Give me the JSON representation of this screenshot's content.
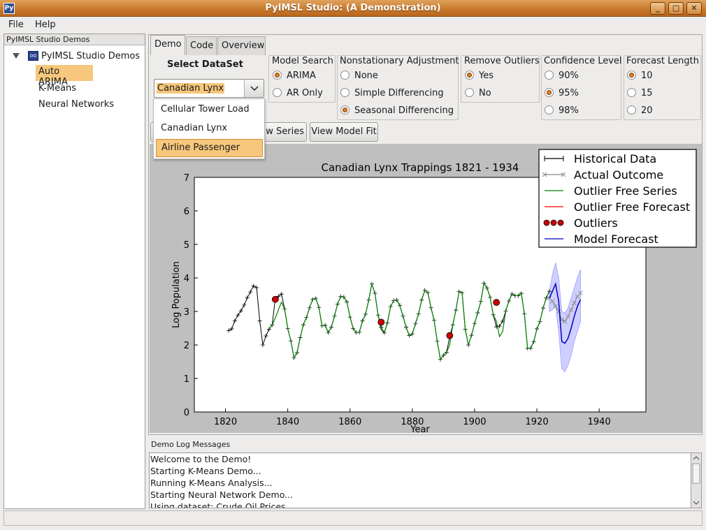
{
  "window": {
    "title": "PyIMSL Studio: (A Demonstration)",
    "app_icon": "Py",
    "min": "_",
    "max": "□",
    "close": "✕"
  },
  "menubar": {
    "file": "File",
    "help": "Help"
  },
  "sidebar": {
    "header": "PyIMSL Studio Demos",
    "root": "PyIMSL Studio Demos",
    "items": [
      {
        "label": "Auto ARIMA",
        "selected": true
      },
      {
        "label": "K-Means",
        "selected": false
      },
      {
        "label": "Neural Networks",
        "selected": false
      }
    ]
  },
  "tabs": [
    {
      "label": "Demo",
      "active": true
    },
    {
      "label": "Code",
      "active": false
    },
    {
      "label": "Overview",
      "active": false
    }
  ],
  "dataset": {
    "title": "Select DataSet",
    "selected": "Canadian Lynx",
    "options": [
      "Cellular Tower Load",
      "Canadian Lynx",
      "Airline Passenger"
    ],
    "highlighted": "Airline Passenger"
  },
  "groups": {
    "model_search": {
      "title": "Model Search",
      "options": [
        "ARIMA",
        "AR Only"
      ],
      "selected": "ARIMA"
    },
    "nonstationary": {
      "title": "Nonstationary Adjustment",
      "options": [
        "None",
        "Simple Differencing",
        "Seasonal Differencing"
      ],
      "selected": "Seasonal Differencing"
    },
    "outliers": {
      "title": "Remove Outliers",
      "options": [
        "Yes",
        "No"
      ],
      "selected": "Yes"
    },
    "confidence": {
      "title": "Confidence Level",
      "options": [
        "90%",
        "95%",
        "98%"
      ],
      "selected": "95%"
    },
    "forecast": {
      "title": "Forecast Length",
      "options": [
        "10",
        "15",
        "20"
      ],
      "selected": "10"
    }
  },
  "buttons": {
    "raw_series": "aw Series",
    "model_fit": "View Model Fit"
  },
  "chart_data": {
    "type": "line",
    "title": "Canadian Lynx Trappings 1821 - 1934",
    "xlabel": "Year",
    "ylabel": "Log Population",
    "xlim": [
      1810,
      1955
    ],
    "ylim": [
      0,
      7
    ],
    "xticks": [
      1820,
      1840,
      1860,
      1880,
      1900,
      1920,
      1940
    ],
    "yticks": [
      0,
      1,
      2,
      3,
      4,
      5,
      6,
      7
    ],
    "legend_position": "upper-right",
    "colors": {
      "historical": "#000000",
      "actual": "#888888",
      "outlier_free": "#007f00",
      "outlier_forecast": "#ff0000",
      "outliers": "#cc0000",
      "model": "#0000bb",
      "band": "#a8a8ff"
    },
    "historical": {
      "name": "Historical Data",
      "x": [
        1821,
        1822,
        1823,
        1824,
        1825,
        1826,
        1827,
        1828,
        1829,
        1830,
        1831,
        1832,
        1833,
        1834,
        1835,
        1836,
        1837,
        1838,
        1839,
        1840,
        1841,
        1842,
        1843,
        1844,
        1845,
        1846,
        1847,
        1848,
        1849,
        1850,
        1851,
        1852,
        1853,
        1854,
        1855,
        1856,
        1857,
        1858,
        1859,
        1860,
        1861,
        1862,
        1863,
        1864,
        1865,
        1866,
        1867,
        1868,
        1869,
        1870,
        1871,
        1872,
        1873,
        1874,
        1875,
        1876,
        1877,
        1878,
        1879,
        1880,
        1881,
        1882,
        1883,
        1884,
        1885,
        1886,
        1887,
        1888,
        1889,
        1890,
        1891,
        1892,
        1893,
        1894,
        1895,
        1896,
        1897,
        1898,
        1899,
        1900,
        1901,
        1902,
        1903,
        1904,
        1905,
        1906,
        1907,
        1908,
        1909,
        1910,
        1911,
        1912,
        1913,
        1914,
        1915,
        1916,
        1917,
        1918,
        1919,
        1920,
        1921,
        1922,
        1923,
        1924
      ],
      "y": [
        2.43,
        2.48,
        2.72,
        2.89,
        3.02,
        3.19,
        3.41,
        3.58,
        3.76,
        3.71,
        2.72,
        2.0,
        2.27,
        2.47,
        2.6,
        3.38,
        3.45,
        3.52,
        3.07,
        2.49,
        2.12,
        1.62,
        1.77,
        2.22,
        2.6,
        2.82,
        3.11,
        3.36,
        3.39,
        3.12,
        2.57,
        2.59,
        2.37,
        2.53,
        2.86,
        3.22,
        3.45,
        3.43,
        3.28,
        2.83,
        2.49,
        2.37,
        2.38,
        2.72,
        2.92,
        3.34,
        3.82,
        3.54,
        2.89,
        2.53,
        2.36,
        2.66,
        3.14,
        3.32,
        3.34,
        3.18,
        2.86,
        2.53,
        2.28,
        2.33,
        2.63,
        2.93,
        3.34,
        3.63,
        3.56,
        3.11,
        2.74,
        2.11,
        1.57,
        1.69,
        1.78,
        2.24,
        2.6,
        3.04,
        3.59,
        3.55,
        2.47,
        2.0,
        2.29,
        2.64,
        2.96,
        3.3,
        3.84,
        3.7,
        3.42,
        2.9,
        2.54,
        2.56,
        2.71,
        3.01,
        3.31,
        3.52,
        3.47,
        3.47,
        3.54,
        2.93,
        1.9,
        1.9,
        2.1,
        2.48,
        2.7,
        3.1,
        3.4,
        3.6
      ]
    },
    "actual": {
      "name": "Actual Outcome",
      "x": [
        1924,
        1925,
        1926,
        1927,
        1928,
        1929,
        1930,
        1931,
        1932,
        1933,
        1934
      ],
      "y": [
        3.4,
        3.3,
        3.15,
        3.0,
        2.75,
        2.7,
        2.85,
        3.05,
        3.25,
        3.45,
        3.55
      ]
    },
    "outlier_free": {
      "name": "Outlier Free Series",
      "x": [
        1834,
        1835,
        1836,
        1837,
        1838,
        1839,
        1840,
        1841,
        1842,
        1843,
        1844,
        1845,
        1846,
        1847,
        1848,
        1849,
        1850,
        1851,
        1852,
        1853,
        1854,
        1855,
        1856,
        1857,
        1858,
        1859,
        1860,
        1861,
        1862,
        1863,
        1864,
        1865,
        1866,
        1867,
        1868,
        1869,
        1870,
        1871,
        1872,
        1873,
        1874,
        1875,
        1876,
        1877,
        1878,
        1879,
        1880,
        1881,
        1882,
        1883,
        1884,
        1885,
        1886,
        1887,
        1888,
        1889,
        1890,
        1891,
        1892,
        1893,
        1894,
        1895,
        1896,
        1897,
        1898,
        1899,
        1900,
        1901,
        1902,
        1903,
        1904,
        1905,
        1906,
        1907,
        1908,
        1909,
        1910,
        1911,
        1912,
        1913,
        1914,
        1915,
        1916,
        1917,
        1918,
        1919,
        1920,
        1921,
        1922,
        1923,
        1924
      ],
      "y": [
        2.47,
        2.6,
        2.8,
        3.05,
        3.28,
        3.07,
        2.49,
        2.12,
        1.62,
        1.77,
        2.22,
        2.6,
        2.82,
        3.11,
        3.36,
        3.39,
        3.12,
        2.57,
        2.59,
        2.37,
        2.53,
        2.86,
        3.22,
        3.45,
        3.43,
        3.28,
        2.83,
        2.49,
        2.37,
        2.38,
        2.72,
        2.92,
        3.34,
        3.82,
        3.54,
        2.89,
        2.45,
        2.36,
        2.66,
        3.14,
        3.32,
        3.34,
        3.18,
        2.86,
        2.53,
        2.28,
        2.33,
        2.63,
        2.93,
        3.34,
        3.63,
        3.56,
        3.11,
        2.74,
        2.11,
        1.57,
        1.69,
        1.78,
        2.0,
        2.6,
        3.04,
        3.59,
        3.55,
        2.47,
        2.0,
        2.29,
        2.64,
        2.96,
        3.3,
        3.84,
        3.7,
        3.42,
        2.9,
        2.7,
        2.25,
        2.4,
        3.01,
        3.31,
        3.52,
        3.47,
        3.47,
        3.54,
        2.93,
        1.9,
        1.9,
        2.1,
        2.48,
        2.7,
        3.1,
        3.4,
        3.6
      ]
    },
    "outlier_free_forecast": {
      "name": "Outlier Free Forecast",
      "x": [],
      "y": []
    },
    "outliers": {
      "name": "Outliers",
      "x": [
        1836,
        1870,
        1892,
        1907
      ],
      "y": [
        3.36,
        2.68,
        2.28,
        3.27
      ]
    },
    "model_forecast": {
      "name": "Model Forecast",
      "x": [
        1924,
        1925,
        1926,
        1927,
        1928,
        1929,
        1930,
        1931,
        1932,
        1933,
        1934
      ],
      "y": [
        3.4,
        3.6,
        3.82,
        3.3,
        2.1,
        2.05,
        2.2,
        2.5,
        2.85,
        3.15,
        3.35
      ],
      "lower": [
        3.0,
        3.05,
        3.2,
        2.4,
        1.3,
        1.2,
        1.4,
        1.7,
        2.1,
        2.4,
        2.7
      ],
      "upper": [
        3.6,
        4.1,
        4.45,
        4.0,
        3.0,
        2.95,
        3.1,
        3.4,
        3.7,
        4.0,
        4.25
      ]
    }
  },
  "log": {
    "title": "Demo Log Messages",
    "lines": [
      "Welcome to the Demo!",
      "Starting K-Means Demo...",
      "Running K-Means Analysis...",
      "Starting Neural Network Demo...",
      "Using dataset: Crude Oil Prices"
    ]
  }
}
